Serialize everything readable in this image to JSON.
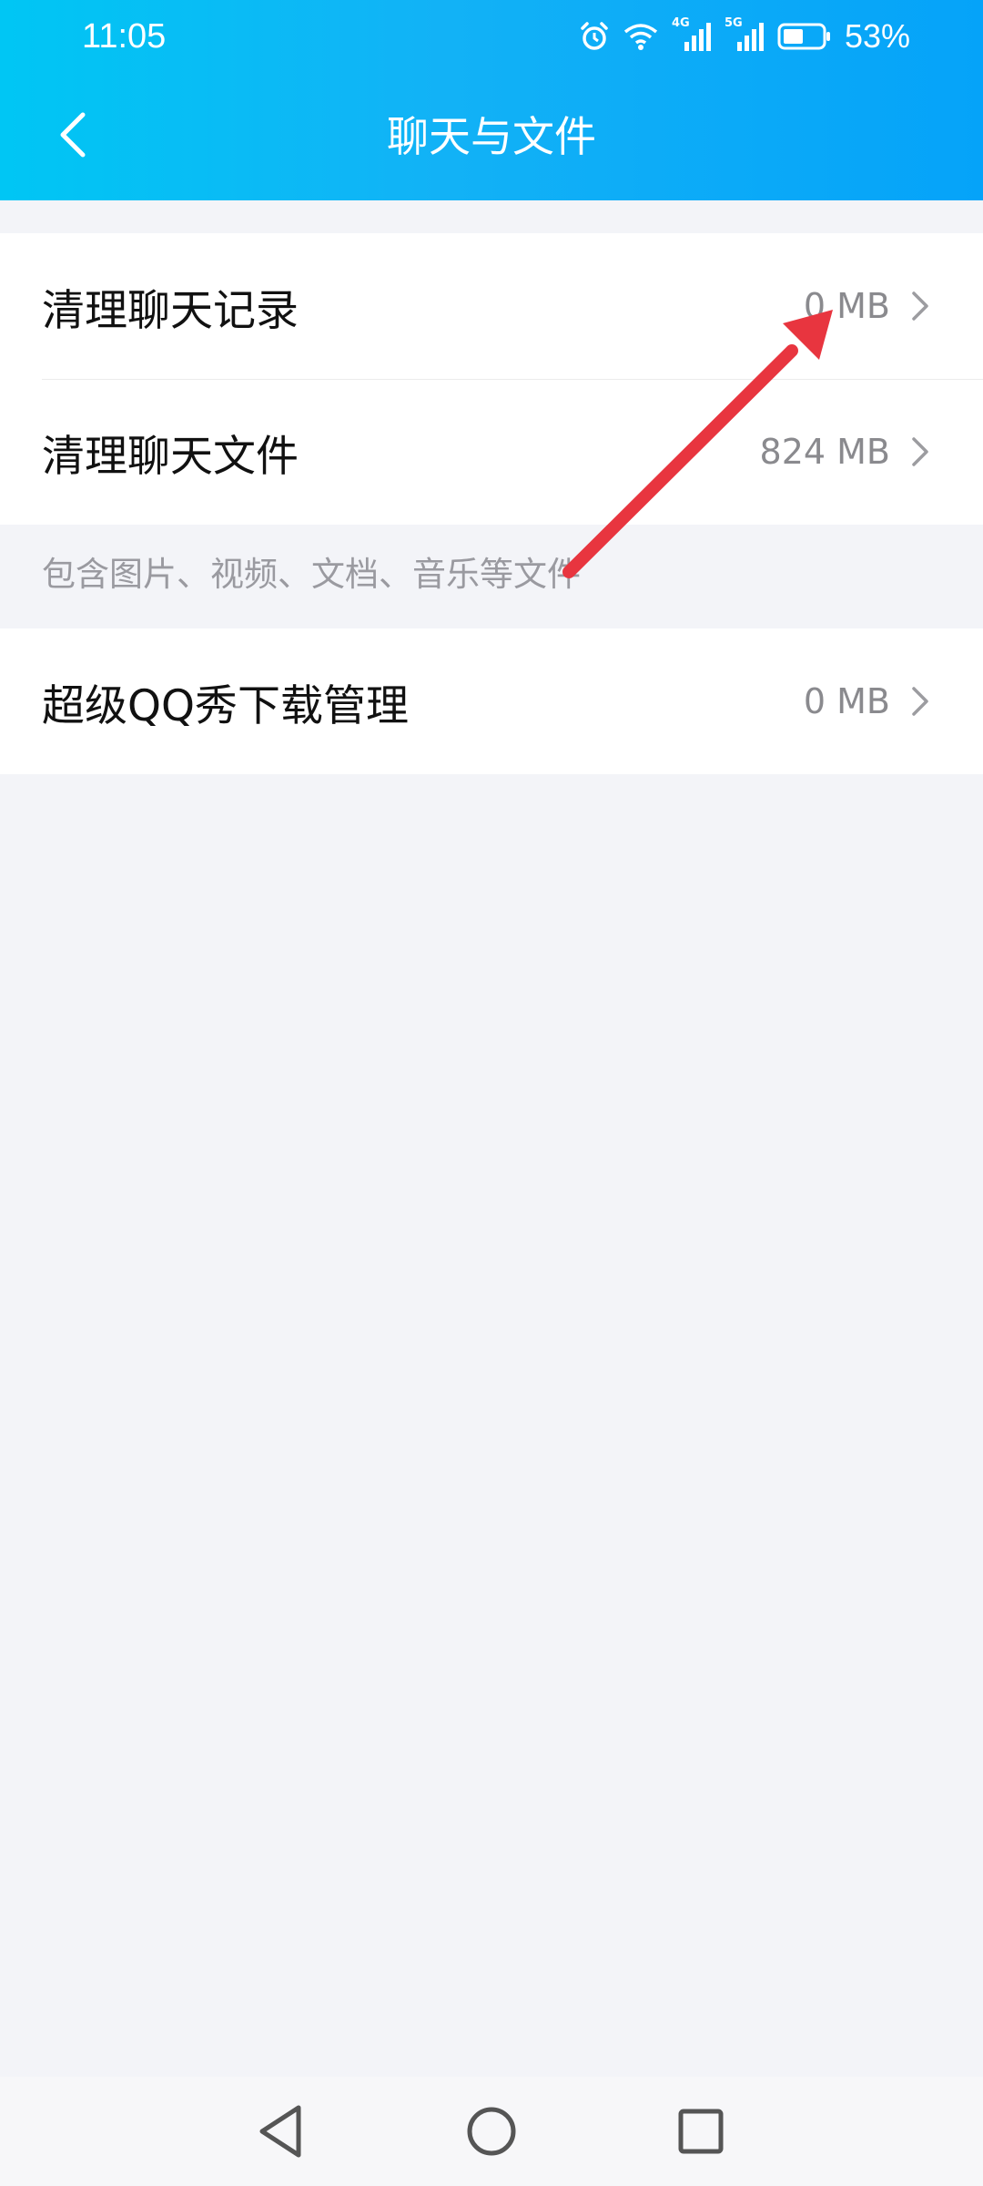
{
  "status_bar": {
    "time": "11:05",
    "network_1": "4G",
    "network_2": "5G",
    "battery_percent": "53%",
    "battery_level": 0.53,
    "icons": [
      "alarm-icon",
      "wifi-icon",
      "signal-icon",
      "signal-icon",
      "battery-icon"
    ]
  },
  "header": {
    "title": "聊天与文件",
    "back_icon": "chevron-left-icon"
  },
  "groups": [
    {
      "items": [
        {
          "label": "清理聊天记录",
          "value": "0 MB"
        },
        {
          "label": "清理聊天文件",
          "value": "824 MB"
        }
      ],
      "hint": "包含图片、视频、文档、音乐等文件"
    },
    {
      "items": [
        {
          "label": "超级QQ秀下载管理",
          "value": "0 MB"
        }
      ]
    }
  ],
  "colors": {
    "header_gradient_start": "#00c6f4",
    "header_gradient_end": "#05a3f9",
    "page_background": "#f3f4f8",
    "annotation_arrow": "#e8353f"
  },
  "system_nav": {
    "icons": [
      "triangle-back-icon",
      "circle-home-icon",
      "square-recents-icon"
    ]
  }
}
